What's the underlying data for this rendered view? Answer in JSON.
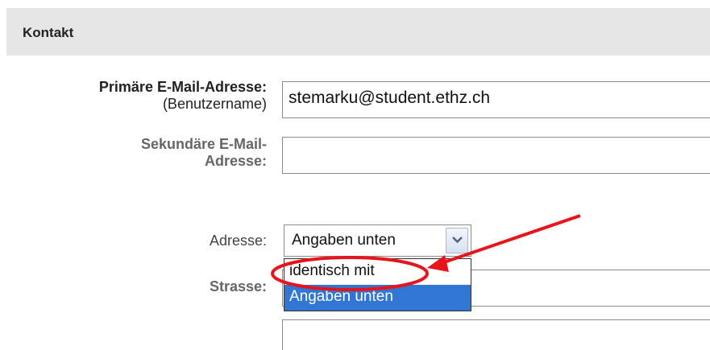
{
  "section": {
    "title": "Kontakt"
  },
  "fields": {
    "primary_email": {
      "label": "Primäre E-Mail-Adresse:",
      "sublabel": "(Benutzername)",
      "value": "stemarku@student.ethz.ch"
    },
    "secondary_email": {
      "label_line1": "Sekundäre E-Mail-",
      "label_line2": "Adresse:",
      "value": ""
    },
    "address": {
      "label": "Adresse:",
      "selected_value": "Angaben unten",
      "options": [
        "identisch mit",
        "Angaben unten"
      ]
    },
    "street": {
      "label": "Strasse:",
      "value": ""
    }
  },
  "colors": {
    "header_bg": "#e6e6e6",
    "selected_option_bg": "#3176d2",
    "annotation": "#e8141c"
  },
  "icons": {
    "select_arrow": "chevron-down-icon"
  }
}
